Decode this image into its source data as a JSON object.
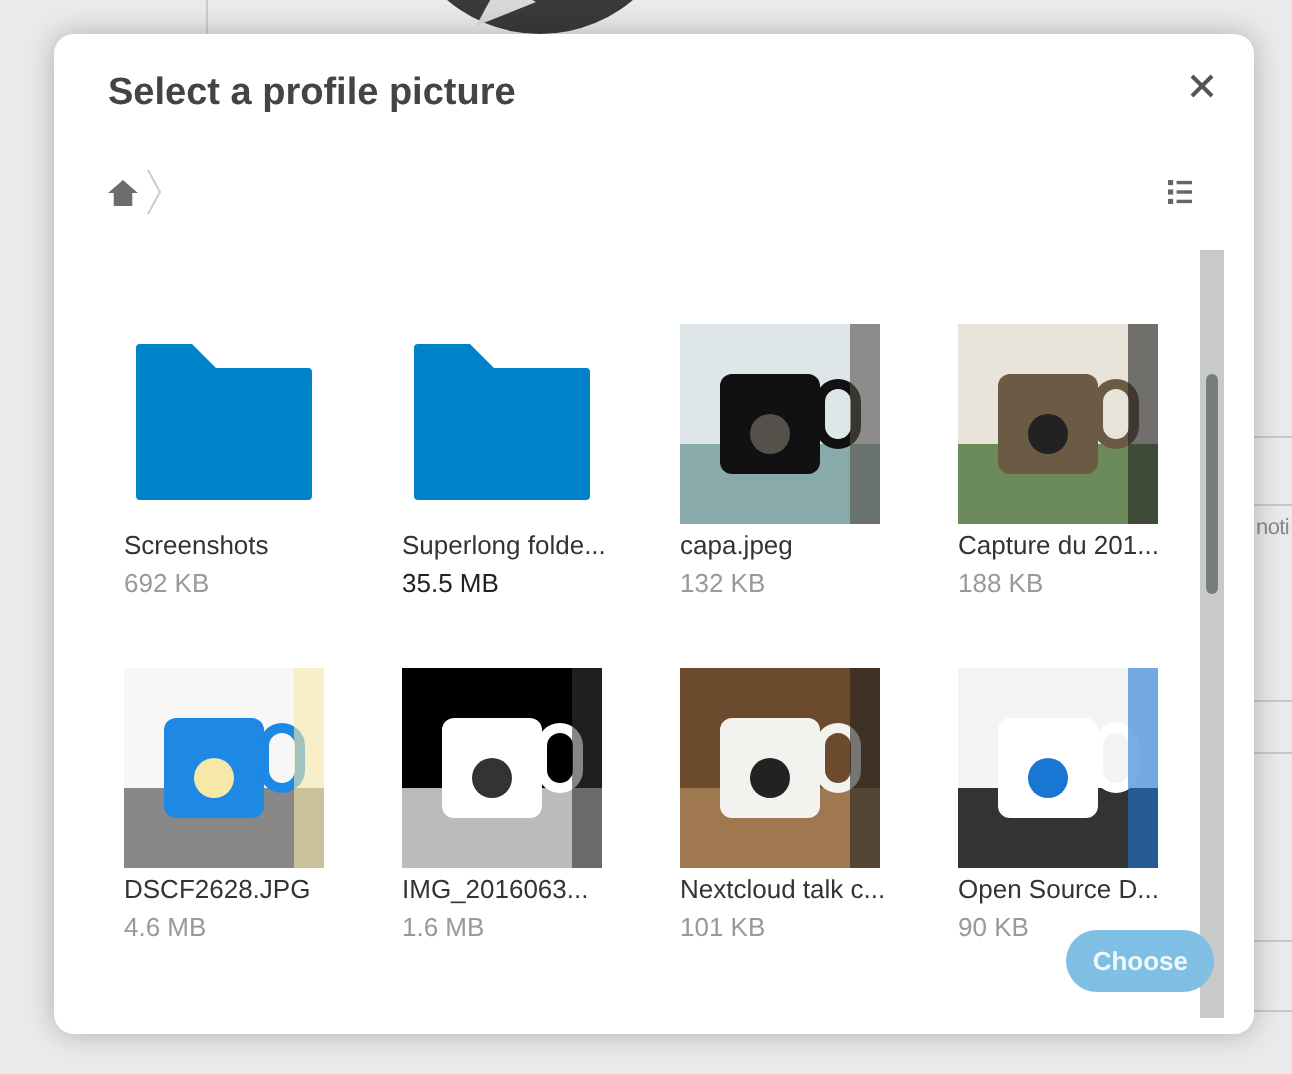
{
  "background": {
    "partial_text": "noti"
  },
  "dialog": {
    "title": "Select a profile picture",
    "files": [
      {
        "kind": "folder",
        "name": "Screenshots",
        "size": "692 KB",
        "size_emphasized": false
      },
      {
        "kind": "folder",
        "name": "Superlong folde...",
        "size": "35.5 MB",
        "size_emphasized": true
      },
      {
        "kind": "picture",
        "name": "capa.jpeg",
        "size": "132 KB",
        "size_emphasized": false
      },
      {
        "kind": "picture",
        "name": "Capture du 201...",
        "size": "188 KB",
        "size_emphasized": false
      },
      {
        "kind": "picture",
        "name": "DSCF2628.JPG",
        "size": "4.6 MB",
        "size_emphasized": false
      },
      {
        "kind": "picture",
        "name": "IMG_2016063...",
        "size": "1.6 MB",
        "size_emphasized": false
      },
      {
        "kind": "picture",
        "name": "Nextcloud talk c...",
        "size": "101 KB",
        "size_emphasized": false
      },
      {
        "kind": "picture",
        "name": "Open Source D...",
        "size": "90 KB",
        "size_emphasized": false
      }
    ],
    "choose_button": {
      "label": "Choose",
      "disabled": true
    }
  }
}
